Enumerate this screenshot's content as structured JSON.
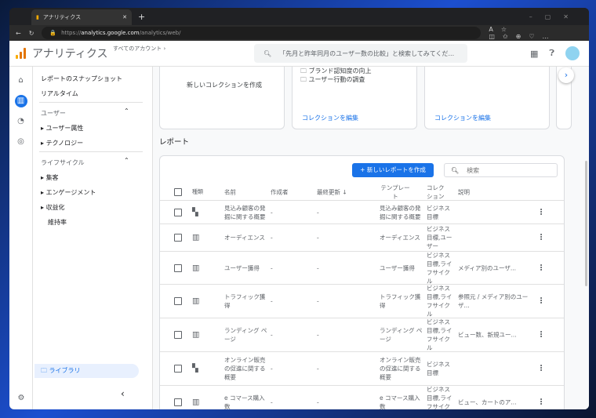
{
  "browser": {
    "tab_title": "アナリティクス",
    "url_prefix": "https://",
    "url_host": "analytics.google.com",
    "url_path": "/analytics/web/"
  },
  "header": {
    "title": "アナリティクス",
    "account": "すべてのアカウント ›",
    "search_placeholder": "「先月と昨年同月のユーザー数の比較」と検索してみてくだ..."
  },
  "sidebar": {
    "items": [
      "レポートのスナップショット",
      "リアルタイム"
    ],
    "section_user": "ユーザー",
    "user_items": [
      "ユーザー属性",
      "テクノロジー"
    ],
    "section_lifecycle": "ライフサイクル",
    "lifecycle_items": [
      "集客",
      "エンゲージメント",
      "収益化"
    ],
    "retention": "維持率",
    "library": "ライブラリ"
  },
  "collections": {
    "new": "新しいコレクションを作成",
    "card2_items": [
      "ブランド認知度の向上",
      "ユーザー行動の調査"
    ],
    "edit": "コレクションを編集"
  },
  "reports": {
    "heading": "レポート",
    "create_button": "新しいレポートを作成",
    "search_placeholder": "検索",
    "columns": [
      "種類",
      "名前",
      "作成者",
      "最終更新 ↓",
      "テンプレート",
      "コレクション",
      "説明"
    ],
    "rows": [
      {
        "type": "overview",
        "name": "見込み顧客の発掘に関する概要",
        "creator": "-",
        "updated": "-",
        "template": "見込み顧客の発掘に関する概要",
        "collection": "ビジネス目標",
        "description": ""
      },
      {
        "type": "detail",
        "name": "オーディエンス",
        "creator": "-",
        "updated": "-",
        "template": "オーディエンス",
        "collection": "ビジネス目標,ユーザー",
        "description": ""
      },
      {
        "type": "detail",
        "name": "ユーザー獲得",
        "creator": "-",
        "updated": "-",
        "template": "ユーザー獲得",
        "collection": "ビジネス目標,ライフサイクル",
        "description": "メディア別のユーザ..."
      },
      {
        "type": "detail",
        "name": "トラフィック獲得",
        "creator": "-",
        "updated": "-",
        "template": "トラフィック獲得",
        "collection": "ビジネス目標,ライフサイクル",
        "description": "参照元 / メディア別のユーザ..."
      },
      {
        "type": "detail",
        "name": "ランディング ページ",
        "creator": "-",
        "updated": "-",
        "template": "ランディング ページ",
        "collection": "ビジネス目標,ライフサイクル",
        "description": "ビュー数、新規ユー..."
      },
      {
        "type": "overview",
        "name": "オンライン販売の促進に関する概要",
        "creator": "-",
        "updated": "-",
        "template": "オンライン販売の促進に関する概要",
        "collection": "ビジネス目標",
        "description": ""
      },
      {
        "type": "detail",
        "name": "e コマース購入数",
        "creator": "-",
        "updated": "-",
        "template": "e コマース購入数",
        "collection": "ビジネス目標,ライフサイクル",
        "description": "ビュー、カートのア..."
      }
    ]
  }
}
